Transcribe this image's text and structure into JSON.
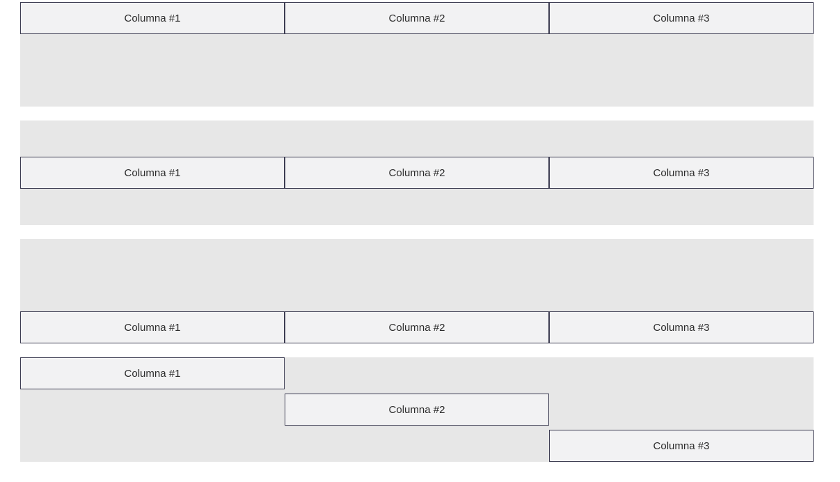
{
  "rows": [
    {
      "alignment": "top",
      "columns": [
        {
          "label": "Columna #1"
        },
        {
          "label": "Columna #2"
        },
        {
          "label": "Columna #3"
        }
      ]
    },
    {
      "alignment": "center",
      "columns": [
        {
          "label": "Columna #1"
        },
        {
          "label": "Columna #2"
        },
        {
          "label": "Columna #3"
        }
      ]
    },
    {
      "alignment": "bottom",
      "columns": [
        {
          "label": "Columna #1"
        },
        {
          "label": "Columna #2"
        },
        {
          "label": "Columna #3"
        }
      ]
    },
    {
      "alignment": "staggered",
      "columns": [
        {
          "label": "Columna #1"
        },
        {
          "label": "Columna #2"
        },
        {
          "label": "Columna #3"
        }
      ]
    }
  ],
  "colors": {
    "row_background": "#e7e7e7",
    "cell_background": "#f2f2f3",
    "cell_border": "#3d3d52",
    "text": "#2b2b2b"
  }
}
